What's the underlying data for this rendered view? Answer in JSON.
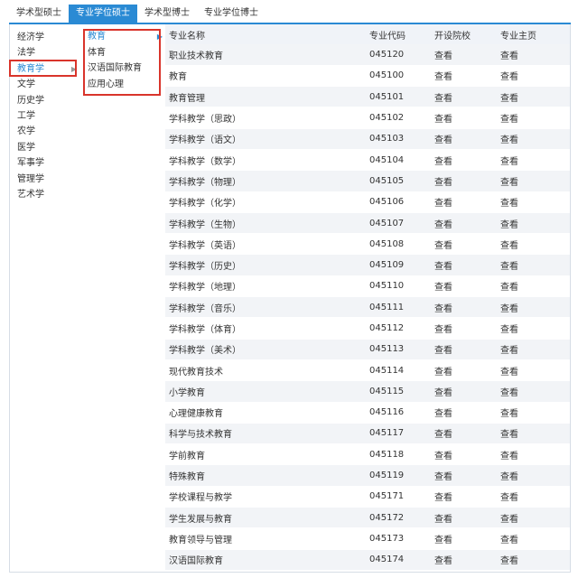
{
  "tabs": [
    {
      "label": "学术型硕士",
      "active": false
    },
    {
      "label": "专业学位硕士",
      "active": true
    },
    {
      "label": "学术型博士",
      "active": false
    },
    {
      "label": "专业学位博士",
      "active": false
    }
  ],
  "categories": [
    "经济学",
    "法学",
    "教育学",
    "文学",
    "历史学",
    "工学",
    "农学",
    "医学",
    "军事学",
    "管理学",
    "艺术学"
  ],
  "active_category": "教育学",
  "subcategories": [
    "教育",
    "体育",
    "汉语国际教育",
    "应用心理"
  ],
  "active_subcategory": "教育",
  "table": {
    "headers": [
      "专业名称",
      "专业代码",
      "开设院校",
      "专业主页"
    ],
    "rows": [
      {
        "name": "职业技术教育",
        "code": "045120",
        "schools": "查看",
        "home": "查看"
      },
      {
        "name": "教育",
        "code": "045100",
        "schools": "查看",
        "home": "查看"
      },
      {
        "name": "教育管理",
        "code": "045101",
        "schools": "查看",
        "home": "查看"
      },
      {
        "name": "学科教学（思政）",
        "code": "045102",
        "schools": "查看",
        "home": "查看"
      },
      {
        "name": "学科教学（语文）",
        "code": "045103",
        "schools": "查看",
        "home": "查看"
      },
      {
        "name": "学科教学（数学）",
        "code": "045104",
        "schools": "查看",
        "home": "查看"
      },
      {
        "name": "学科教学（物理）",
        "code": "045105",
        "schools": "查看",
        "home": "查看"
      },
      {
        "name": "学科教学（化学）",
        "code": "045106",
        "schools": "查看",
        "home": "查看"
      },
      {
        "name": "学科教学（生物）",
        "code": "045107",
        "schools": "查看",
        "home": "查看"
      },
      {
        "name": "学科教学（英语）",
        "code": "045108",
        "schools": "查看",
        "home": "查看"
      },
      {
        "name": "学科教学（历史）",
        "code": "045109",
        "schools": "查看",
        "home": "查看"
      },
      {
        "name": "学科教学（地理）",
        "code": "045110",
        "schools": "查看",
        "home": "查看"
      },
      {
        "name": "学科教学（音乐）",
        "code": "045111",
        "schools": "查看",
        "home": "查看"
      },
      {
        "name": "学科教学（体育）",
        "code": "045112",
        "schools": "查看",
        "home": "查看"
      },
      {
        "name": "学科教学（美术）",
        "code": "045113",
        "schools": "查看",
        "home": "查看"
      },
      {
        "name": "现代教育技术",
        "code": "045114",
        "schools": "查看",
        "home": "查看"
      },
      {
        "name": "小学教育",
        "code": "045115",
        "schools": "查看",
        "home": "查看"
      },
      {
        "name": "心理健康教育",
        "code": "045116",
        "schools": "查看",
        "home": "查看"
      },
      {
        "name": "科学与技术教育",
        "code": "045117",
        "schools": "查看",
        "home": "查看"
      },
      {
        "name": "学前教育",
        "code": "045118",
        "schools": "查看",
        "home": "查看"
      },
      {
        "name": "特殊教育",
        "code": "045119",
        "schools": "查看",
        "home": "查看"
      },
      {
        "name": "学校课程与教学",
        "code": "045171",
        "schools": "查看",
        "home": "查看"
      },
      {
        "name": "学生发展与教育",
        "code": "045172",
        "schools": "查看",
        "home": "查看"
      },
      {
        "name": "教育领导与管理",
        "code": "045173",
        "schools": "查看",
        "home": "查看"
      },
      {
        "name": "汉语国际教育",
        "code": "045174",
        "schools": "查看",
        "home": "查看"
      }
    ]
  },
  "colors": {
    "accent": "#2a8ad4",
    "highlight_box": "#d9342b",
    "row_alt": "#f2f4f7",
    "header_bg": "#f0f3f8"
  }
}
